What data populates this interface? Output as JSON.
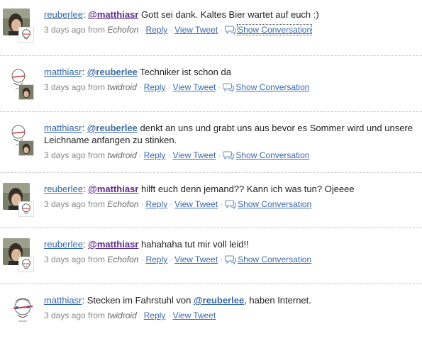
{
  "tweets": [
    {
      "user": "reuberlee",
      "mention": "@matthiasr",
      "text": " Gott sei dank. Kaltes Bier wartet auf euch :)",
      "time": "3 days ago from",
      "source": "Echofon",
      "reply": "Reply",
      "view": "View Tweet",
      "conversation": "Show Conversation",
      "avatar": "photo-avatar"
    },
    {
      "user": "matthiasr",
      "mention": "@reuberlee",
      "text": " Techniker ist schon da",
      "time": "3 days ago from",
      "source": "twidroid",
      "reply": "Reply",
      "view": "View Tweet",
      "conversation": "Show Conversation",
      "avatar": "sketch-avatar"
    },
    {
      "user": "matthiasr",
      "mention": "@reuberlee",
      "text": " denkt an uns und grabt uns aus bevor es Sommer wird und unsere Leichname anfangen zu stinken.",
      "time": "3 days ago from",
      "source": "twidroid",
      "reply": "Reply",
      "view": "View Tweet",
      "conversation": "Show Conversation",
      "avatar": "sketch-avatar"
    },
    {
      "user": "reuberlee",
      "mention": "@matthiasr",
      "text": " hilft euch denn jemand?? Kann ich was tun? Ojeeee",
      "time": "3 days ago from",
      "source": "Echofon",
      "reply": "Reply",
      "view": "View Tweet",
      "conversation": "Show Conversation",
      "avatar": "photo-avatar"
    },
    {
      "user": "reuberlee",
      "mention": "@matthiasr",
      "text": " hahahaha tut mir voll leid!!",
      "time": "3 days ago from",
      "source": "Echofon",
      "reply": "Reply",
      "view": "View Tweet",
      "conversation": "Show Conversation",
      "avatar": "photo-avatar"
    },
    {
      "user": "matthiasr",
      "text_before": ": Stecken im Fahrstuhl von ",
      "mention": "@reuberlee",
      "text": ", haben Internet.",
      "time": "3 days ago from",
      "source": "twidroid",
      "reply": "Reply",
      "view": "View Tweet",
      "avatar": "sketch-avatar-large"
    }
  ],
  "colors": {
    "link": "#3b6aa8",
    "mention": "#5a2c8a",
    "divider": "#c8c8c8"
  }
}
